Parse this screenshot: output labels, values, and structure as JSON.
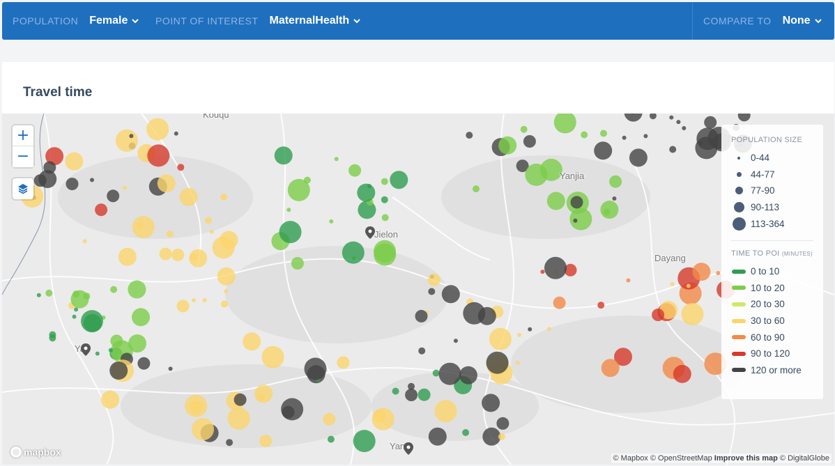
{
  "filters": {
    "population": {
      "label": "POPULATION",
      "value": "Female"
    },
    "poi": {
      "label": "POINT OF INTEREST",
      "value": "MaternalHealth"
    },
    "compare": {
      "label": "COMPARE TO",
      "value": "None"
    }
  },
  "card": {
    "title": "Travel time"
  },
  "map": {
    "zoom_in": "+",
    "zoom_out": "−",
    "places": [
      "Yanjia",
      "Dayang",
      "Ya",
      "Yan",
      "Kouqu",
      "Jielon"
    ],
    "attribution": {
      "mapbox": "© Mapbox",
      "osm": "© OpenStreetMap",
      "improve": "Improve this map",
      "dg": "© DigitalGlobe"
    },
    "logo": "mapbox"
  },
  "legend": {
    "size_title": "POPULATION SIZE",
    "sizes": [
      "0-44",
      "44-77",
      "77-90",
      "90-113",
      "113-364"
    ],
    "time_title": "TIME TO POI",
    "time_unit": "(MINUTES)",
    "times": [
      {
        "label": "0 to 10",
        "color": "#2e9e4f"
      },
      {
        "label": "10 to 20",
        "color": "#7ccd4a"
      },
      {
        "label": "20 to 30",
        "color": "#cfe86a"
      },
      {
        "label": "30 to 60",
        "color": "#fbd46b"
      },
      {
        "label": "60 to 90",
        "color": "#f28a48"
      },
      {
        "label": "90 to 120",
        "color": "#d63a2a"
      },
      {
        "label": "120 or more",
        "color": "#444444"
      }
    ]
  }
}
